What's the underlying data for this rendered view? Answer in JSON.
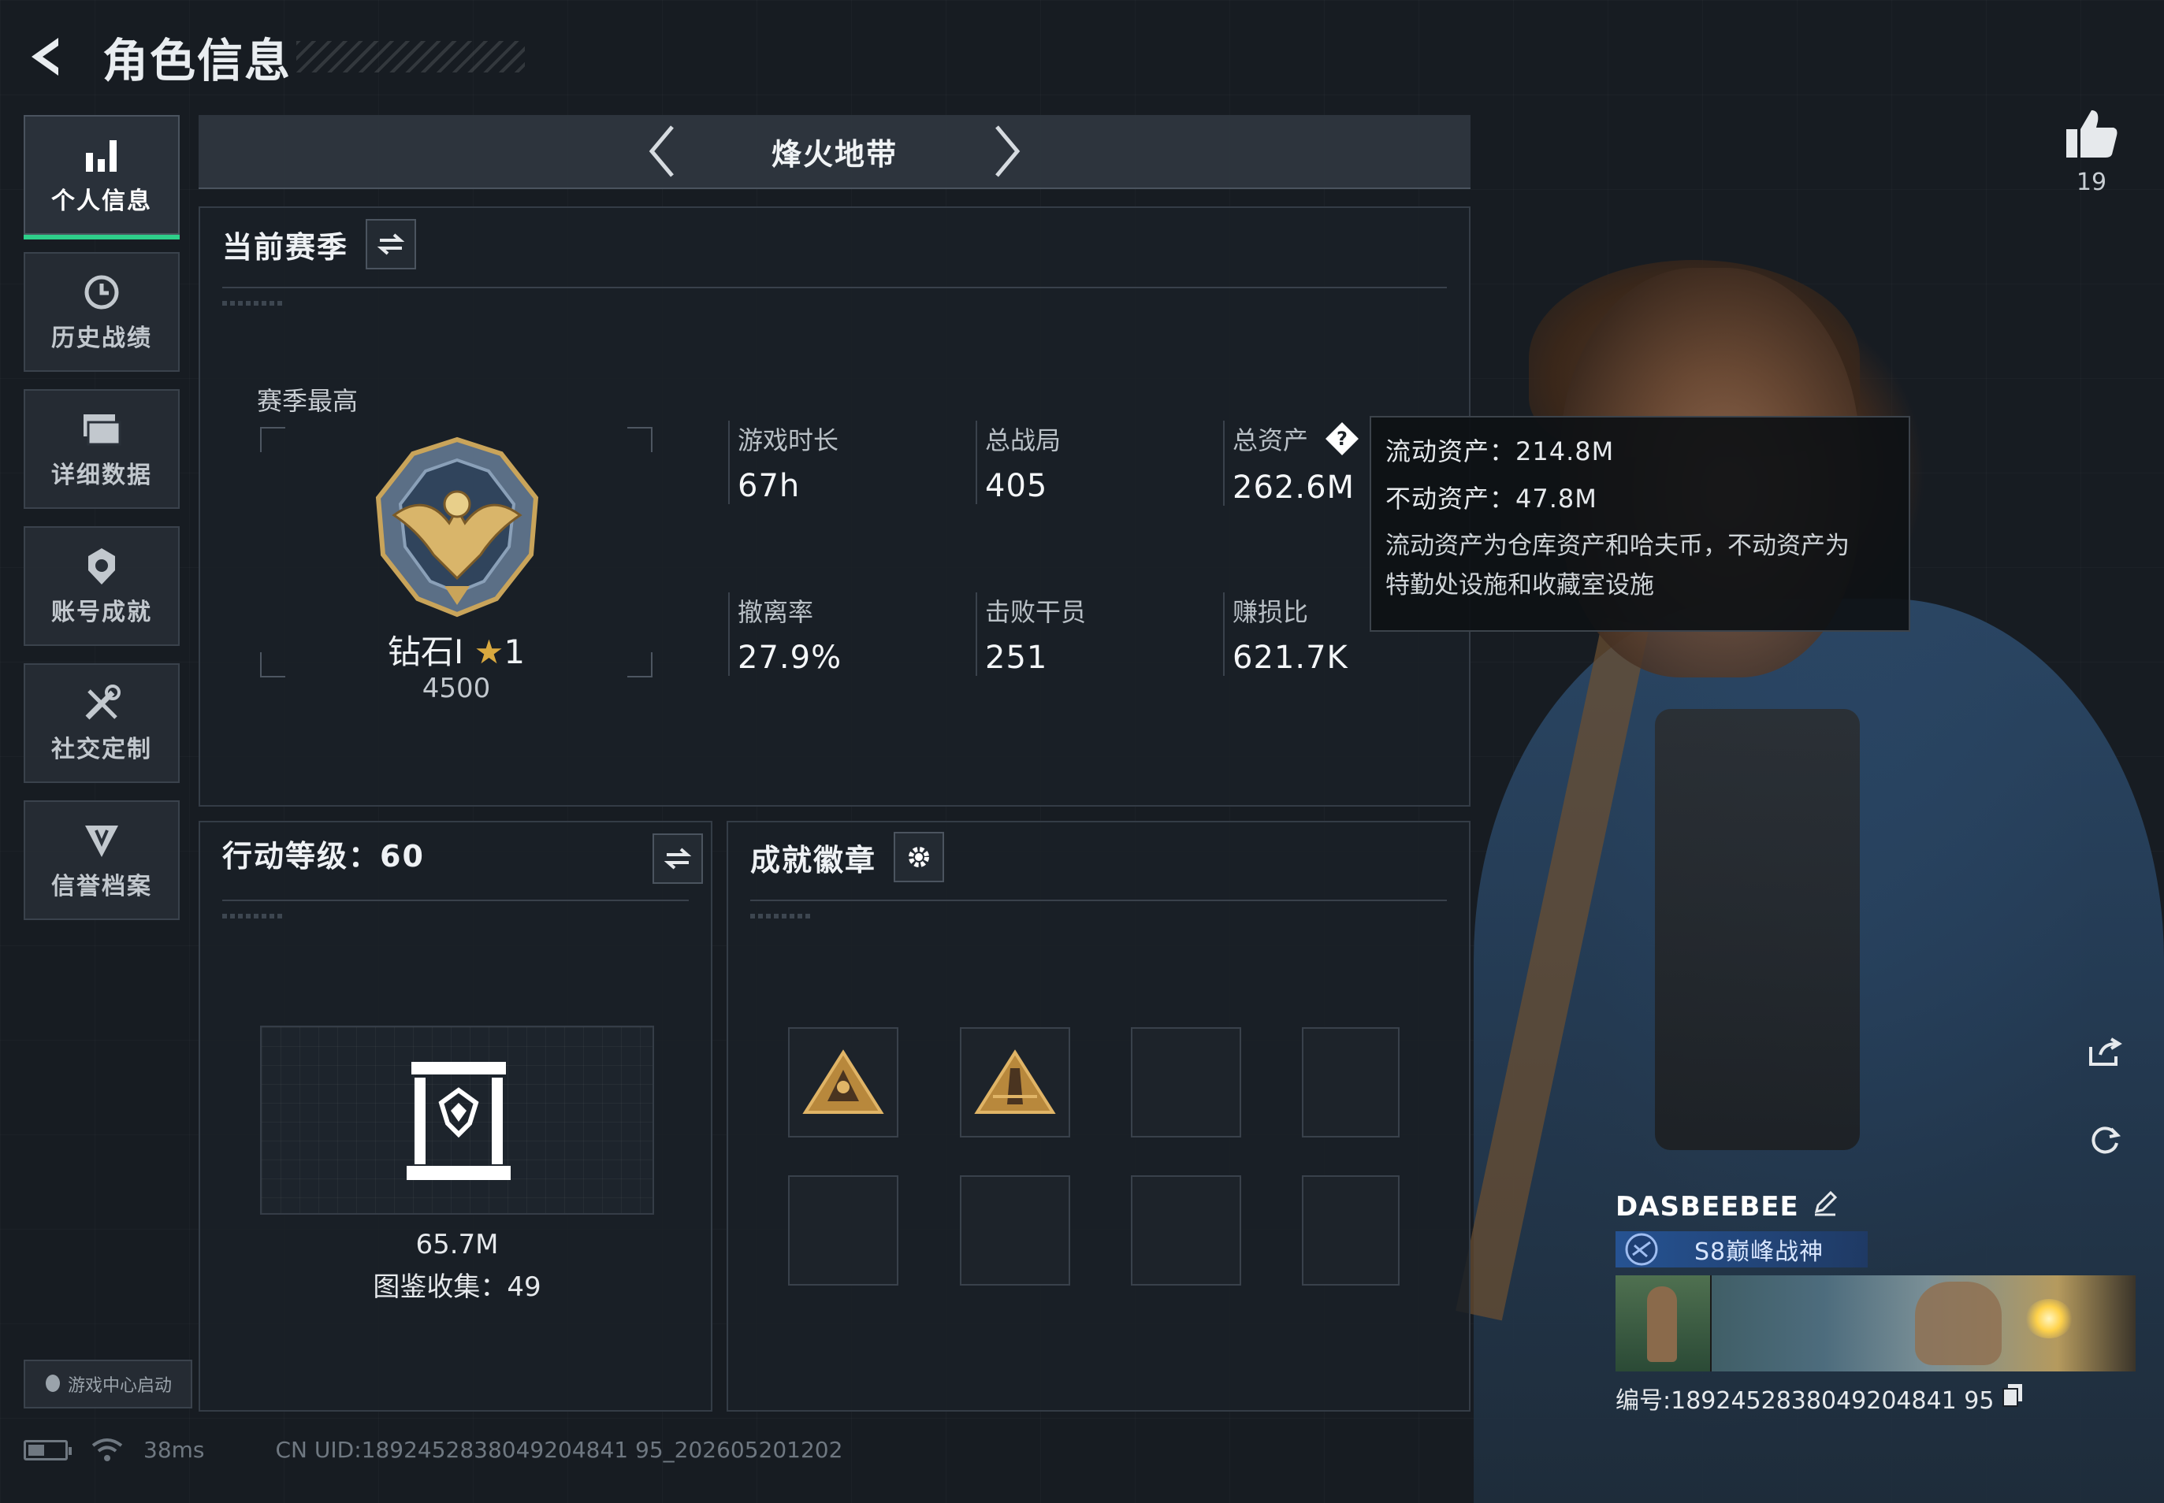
{
  "header": {
    "title": "角色信息"
  },
  "sidebar": {
    "items": [
      {
        "label": "个人信息",
        "icon": "bar-chart-icon",
        "active": true
      },
      {
        "label": "历史战绩",
        "icon": "clock-icon",
        "active": false
      },
      {
        "label": "详细数据",
        "icon": "folder-icon",
        "active": false
      },
      {
        "label": "账号成就",
        "icon": "achievement-icon",
        "active": false
      },
      {
        "label": "社交定制",
        "icon": "tools-icon",
        "active": false
      },
      {
        "label": "信誉档案",
        "icon": "shield-icon",
        "active": false
      }
    ],
    "game_center": "游戏中心启动"
  },
  "status": {
    "ping": "38ms",
    "uid": "CN UID:1892452838049204841 95_202605201202"
  },
  "mode": {
    "title": "烽火地带"
  },
  "season": {
    "title": "当前赛季",
    "best_label": "赛季最高",
    "rank_name": "钻石Ⅰ",
    "rank_stars": "1",
    "rank_score": "4500",
    "stats": [
      {
        "label": "游戏时长",
        "value": "67h"
      },
      {
        "label": "总战局",
        "value": "405"
      },
      {
        "label": "总资产",
        "value": "262.6M"
      },
      {
        "label": "撤离率",
        "value": "27.9%"
      },
      {
        "label": "击败干员",
        "value": "251"
      },
      {
        "label": "赚损比",
        "value": "621.7K"
      }
    ]
  },
  "tooltip": {
    "liquid": "流动资产：214.8M",
    "fixed": "不动资产：47.8M",
    "desc_line1": "流动资产为仓库资产和哈夫币，不动资产为",
    "desc_line2": "特勤处设施和收藏室设施"
  },
  "level": {
    "title": "行动等级：60",
    "value": "65.7M",
    "collection": "图鉴收集：49"
  },
  "badges": {
    "title": "成就徽章",
    "slots": [
      "badge-rank-a",
      "badge-rank-b",
      "",
      "",
      "",
      "",
      "",
      ""
    ]
  },
  "likes": {
    "count": "19"
  },
  "player": {
    "name": "DASBEEBEE",
    "title": "S8巅峰战神",
    "id": "编号:1892452838049204841 95"
  },
  "colors": {
    "accent": "#2ecf8a",
    "gold": "#d9a93f",
    "title_blue": "#2a5aa0"
  }
}
